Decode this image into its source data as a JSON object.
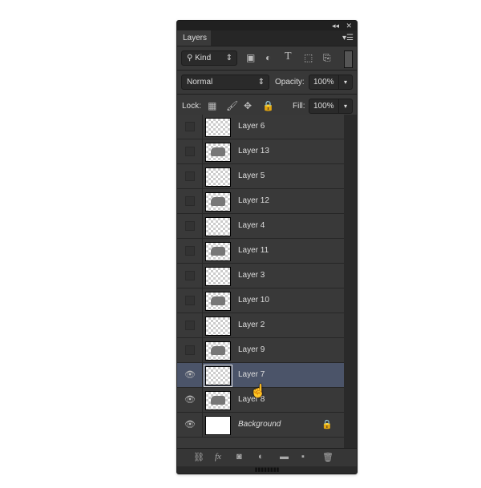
{
  "panel": {
    "collapse_icon": "double-chevron-left",
    "close_icon": "close",
    "tab": "Layers",
    "menu_icon": "panel-menu"
  },
  "filter": {
    "kind": "Kind",
    "icons": [
      "image-filter",
      "adjustment-filter",
      "type-filter",
      "shape-filter",
      "smart-object-filter"
    ]
  },
  "blend": {
    "mode": "Normal",
    "opacity_label": "Opacity:",
    "opacity": "100%"
  },
  "lock": {
    "label": "Lock:",
    "icons": [
      "lock-transparent",
      "lock-paint",
      "lock-position",
      "lock-all"
    ],
    "fill_label": "Fill:",
    "fill": "100%"
  },
  "layers": [
    {
      "name": "Layer 6",
      "visible": false,
      "thumb": "dots"
    },
    {
      "name": "Layer 13",
      "visible": false,
      "thumb": "cat"
    },
    {
      "name": "Layer 5",
      "visible": false,
      "thumb": "dots"
    },
    {
      "name": "Layer 12",
      "visible": false,
      "thumb": "cat"
    },
    {
      "name": "Layer 4",
      "visible": false,
      "thumb": "dots"
    },
    {
      "name": "Layer 11",
      "visible": false,
      "thumb": "cat"
    },
    {
      "name": "Layer 3",
      "visible": false,
      "thumb": "dots"
    },
    {
      "name": "Layer 10",
      "visible": false,
      "thumb": "cat"
    },
    {
      "name": "Layer 2",
      "visible": false,
      "thumb": "dots"
    },
    {
      "name": "Layer 9",
      "visible": false,
      "thumb": "cat"
    },
    {
      "name": "Layer 7",
      "visible": true,
      "thumb": "dots",
      "selected": true
    },
    {
      "name": "Layer 8",
      "visible": true,
      "thumb": "cat"
    },
    {
      "name": "Background",
      "visible": true,
      "thumb": "white",
      "locked": true
    }
  ],
  "footer": [
    "link-layers",
    "fx",
    "add-mask",
    "adjustment",
    "new-group",
    "new-layer",
    "delete"
  ]
}
